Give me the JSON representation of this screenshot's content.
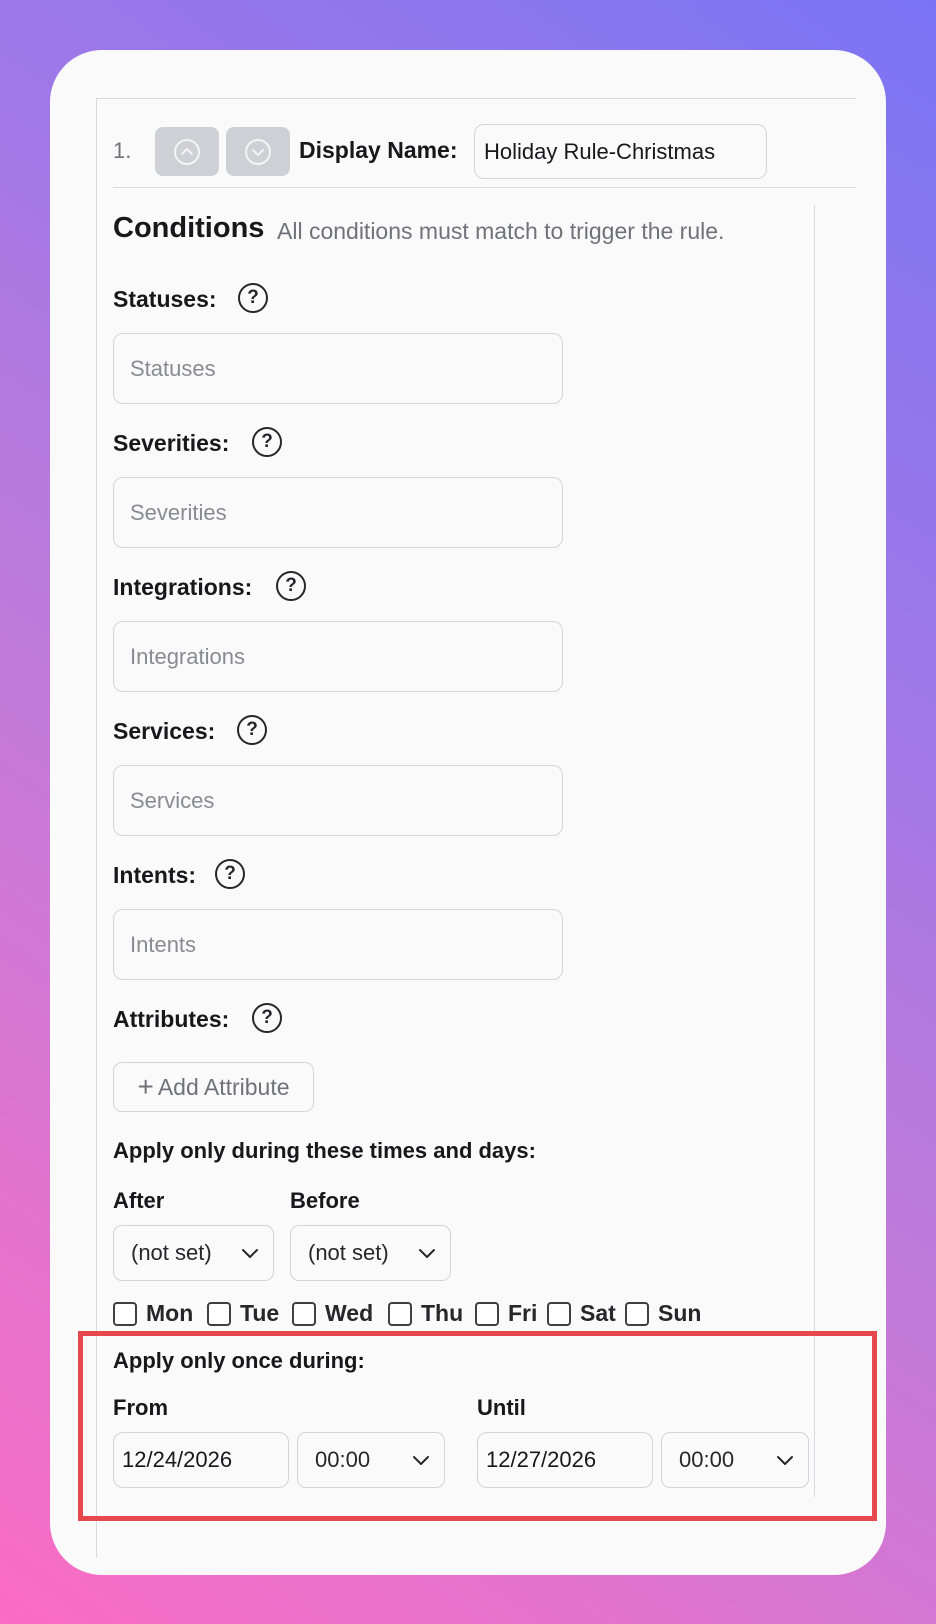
{
  "rule": {
    "number": "1.",
    "display_name_label": "Display Name:",
    "display_name_value": "Holiday Rule-Christmas"
  },
  "conditions": {
    "title": "Conditions",
    "subtitle": "All conditions must match to trigger the rule.",
    "fields": [
      {
        "label": "Statuses:",
        "placeholder": "Statuses"
      },
      {
        "label": "Severities:",
        "placeholder": "Severities"
      },
      {
        "label": "Integrations:",
        "placeholder": "Integrations"
      },
      {
        "label": "Services:",
        "placeholder": "Services"
      },
      {
        "label": "Intents:",
        "placeholder": "Intents"
      }
    ],
    "attributes_label": "Attributes:",
    "add_attribute_label": "Add Attribute",
    "help_glyph": "?"
  },
  "schedule": {
    "title": "Apply only during these times and days:",
    "after_label": "After",
    "after_value": "(not set)",
    "before_label": "Before",
    "before_value": "(not set)",
    "days": [
      "Mon",
      "Tue",
      "Wed",
      "Thu",
      "Fri",
      "Sat",
      "Sun"
    ]
  },
  "once": {
    "title": "Apply only once during:",
    "from_label": "From",
    "from_date": "12/24/2026",
    "from_time": "00:00",
    "until_label": "Until",
    "until_date": "12/27/2026",
    "until_time": "00:00"
  },
  "colors": {
    "highlight": "#e5484d",
    "button_gray": "#cfcfd6"
  }
}
